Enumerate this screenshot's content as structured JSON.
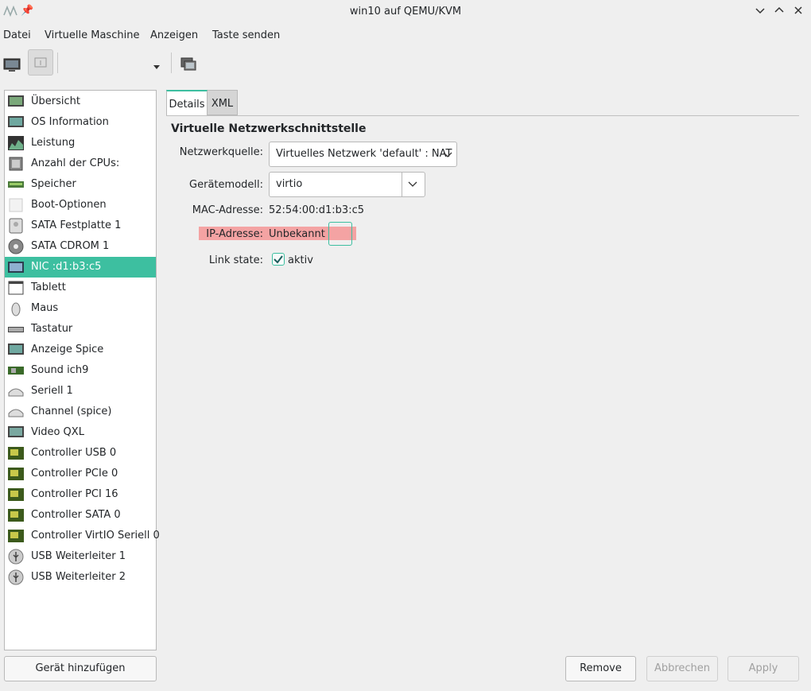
{
  "window": {
    "title": "win10 auf QEMU/KVM"
  },
  "menu": [
    "Datei",
    "Virtuelle Maschine",
    "Anzeigen",
    "Taste senden"
  ],
  "sidebar": {
    "items": [
      {
        "label": "Übersicht",
        "icon": "overview-icon"
      },
      {
        "label": "OS Information",
        "icon": "os-info-icon"
      },
      {
        "label": "Leistung",
        "icon": "performance-icon"
      },
      {
        "label": "Anzahl der CPUs:",
        "icon": "cpu-icon"
      },
      {
        "label": "Speicher",
        "icon": "memory-icon"
      },
      {
        "label": "Boot-Optionen",
        "icon": "boot-icon"
      },
      {
        "label": "SATA Festplatte 1",
        "icon": "disk-icon"
      },
      {
        "label": "SATA CDROM 1",
        "icon": "cdrom-icon"
      },
      {
        "label": "NIC :d1:b3:c5",
        "icon": "nic-icon"
      },
      {
        "label": "Tablett",
        "icon": "tablet-icon"
      },
      {
        "label": "Maus",
        "icon": "mouse-icon"
      },
      {
        "label": "Tastatur",
        "icon": "keyboard-icon"
      },
      {
        "label": "Anzeige Spice",
        "icon": "display-icon"
      },
      {
        "label": "Sound ich9",
        "icon": "sound-icon"
      },
      {
        "label": "Seriell 1",
        "icon": "serial-icon"
      },
      {
        "label": "Channel (spice)",
        "icon": "channel-icon"
      },
      {
        "label": "Video QXL",
        "icon": "video-icon"
      },
      {
        "label": "Controller USB 0",
        "icon": "controller-icon"
      },
      {
        "label": "Controller PCIe 0",
        "icon": "controller-icon"
      },
      {
        "label": "Controller PCI 16",
        "icon": "controller-icon"
      },
      {
        "label": "Controller SATA 0",
        "icon": "controller-icon"
      },
      {
        "label": "Controller VirtIO Seriell 0",
        "icon": "controller-icon"
      },
      {
        "label": "USB Weiterleiter 1",
        "icon": "usb-icon"
      },
      {
        "label": "USB Weiterleiter 2",
        "icon": "usb-icon"
      }
    ],
    "selected_index": 8,
    "add_button": "Gerät hinzufügen"
  },
  "tabs": [
    "Details",
    "XML"
  ],
  "details": {
    "section_title": "Virtuelle Netzwerkschnittstelle",
    "network_source": {
      "label": "Netzwerkquelle:",
      "value": "Virtuelles Netzwerk 'default' : NAT"
    },
    "device_model": {
      "label": "Gerätemodell:",
      "value": "virtio"
    },
    "mac": {
      "label": "MAC-Adresse:",
      "value": "52:54:00:d1:b3:c5"
    },
    "ip": {
      "label": "IP-Adresse:",
      "value": "Unbekannt"
    },
    "link_state": {
      "label": "Link state:",
      "value": "aktiv",
      "checked": true
    }
  },
  "buttons": {
    "remove": "Remove",
    "cancel": "Abbrechen",
    "apply": "Apply"
  },
  "colors": {
    "accent": "#3dbfa0",
    "highlight": "#f4a3a3"
  }
}
